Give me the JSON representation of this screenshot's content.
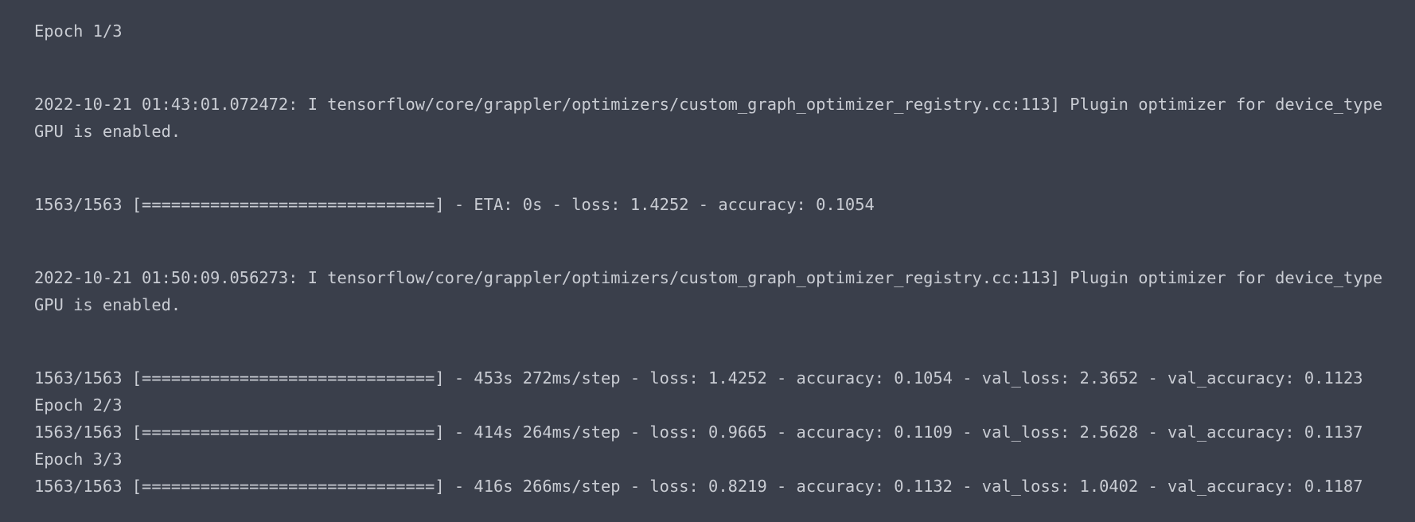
{
  "output": {
    "epoch1_header": "Epoch 1/3",
    "log1_line1": "2022-10-21 01:43:01.072472: I tensorflow/core/grappler/optimizers/custom_graph_optimizer_registry.cc:113] Plugin optimizer for device_type",
    "log1_line2": "GPU is enabled.",
    "progress_eta": "1563/1563 [==============================] - ETA: 0s - loss: 1.4252 - accuracy: 0.1054",
    "log2_line1": "2022-10-21 01:50:09.056273: I tensorflow/core/grappler/optimizers/custom_graph_optimizer_registry.cc:113] Plugin optimizer for device_type",
    "log2_line2": "GPU is enabled.",
    "epoch1_result": "1563/1563 [==============================] - 453s 272ms/step - loss: 1.4252 - accuracy: 0.1054 - val_loss: 2.3652 - val_accuracy: 0.1123",
    "epoch2_header": "Epoch 2/3",
    "epoch2_result": "1563/1563 [==============================] - 414s 264ms/step - loss: 0.9665 - accuracy: 0.1109 - val_loss: 2.5628 - val_accuracy: 0.1137",
    "epoch3_header": "Epoch 3/3",
    "epoch3_result": "1563/1563 [==============================] - 416s 266ms/step - loss: 0.8219 - accuracy: 0.1132 - val_loss: 1.0402 - val_accuracy: 0.1187"
  },
  "colors": {
    "background": "#3a3f4b",
    "text": "#c9ccd3"
  }
}
